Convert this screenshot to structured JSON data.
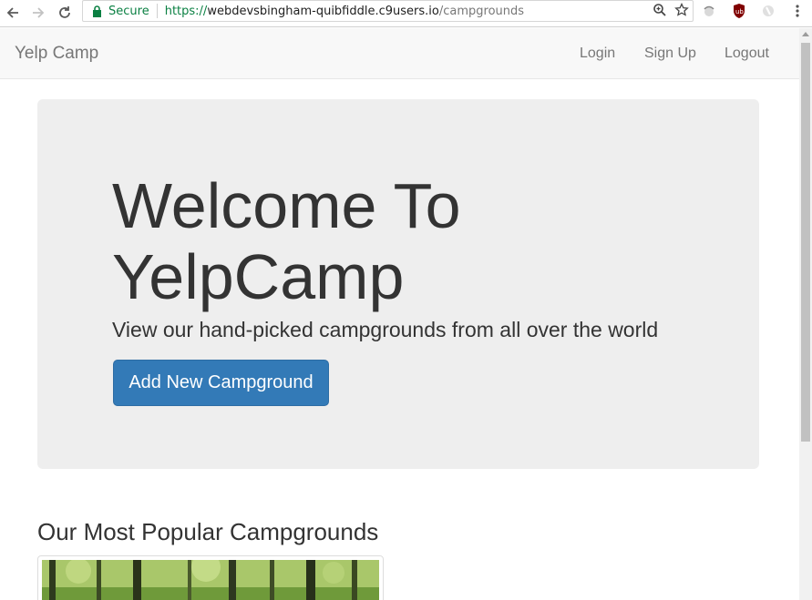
{
  "browser": {
    "secure_label": "Secure",
    "url_scheme": "https://",
    "url_host": "webdevsbingham-quibfiddle.c9users.io",
    "url_path": "/campgrounds"
  },
  "navbar": {
    "brand": "Yelp Camp",
    "links": [
      "Login",
      "Sign Up",
      "Logout"
    ]
  },
  "jumbotron": {
    "title": "Welcome To YelpCamp",
    "lead": "View our hand-picked campgrounds from all over the world",
    "button_label": "Add New Campground"
  },
  "section": {
    "heading": "Our Most Popular Campgrounds"
  },
  "colors": {
    "primary": "#337ab7",
    "jumbotron_bg": "#eeeeee",
    "navbar_bg": "#f8f8f8",
    "secure_green": "#0b8043"
  }
}
